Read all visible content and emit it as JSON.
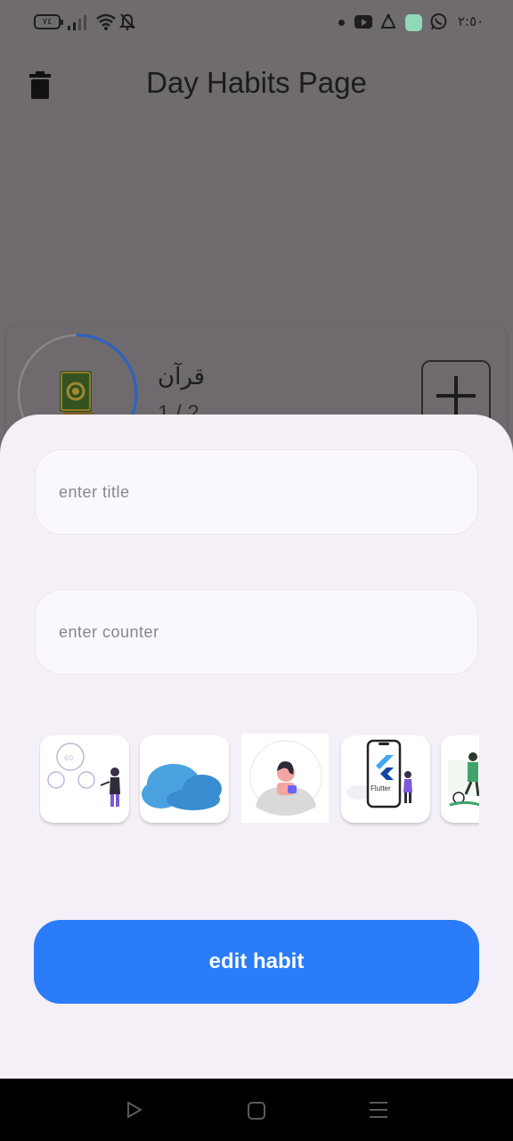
{
  "status_bar": {
    "battery": "٧٤",
    "time": "٢:٥٠",
    "icons": [
      "signal-icon",
      "wifi-icon",
      "bell-off-icon",
      "dot-icon",
      "youtube-icon",
      "app-icon",
      "green-app-icon",
      "whatsapp-icon"
    ]
  },
  "header": {
    "title": "Day Habits Page",
    "delete_icon": "trash-icon"
  },
  "habit_card": {
    "title": "قرآن",
    "count": "1 / 2",
    "progress": 0.5,
    "icon": "quran-icon",
    "add_icon": "plus-icon",
    "colors": {
      "ring": "#2a62c4",
      "ring_track": "#8a868a"
    }
  },
  "sheet": {
    "title_field": {
      "placeholder": "enter title",
      "value": ""
    },
    "counter_field": {
      "placeholder": "enter counter",
      "value": ""
    },
    "images": [
      {
        "name": "clocks-illustration",
        "selected": false
      },
      {
        "name": "weather-cloud-moon-illustration",
        "selected": false
      },
      {
        "name": "person-reading-illustration",
        "selected": true
      },
      {
        "name": "flutter-phone-illustration",
        "selected": false,
        "label": "Flutter"
      },
      {
        "name": "sport-illustration",
        "selected": false
      }
    ],
    "submit_label": "edit habit"
  },
  "colors": {
    "accent": "#2a7cf8",
    "scrim": "#6f6b6f",
    "sheet": "#f5eff8"
  },
  "nav_bar": {
    "icons": [
      "back-icon",
      "home-icon",
      "recents-icon"
    ]
  }
}
